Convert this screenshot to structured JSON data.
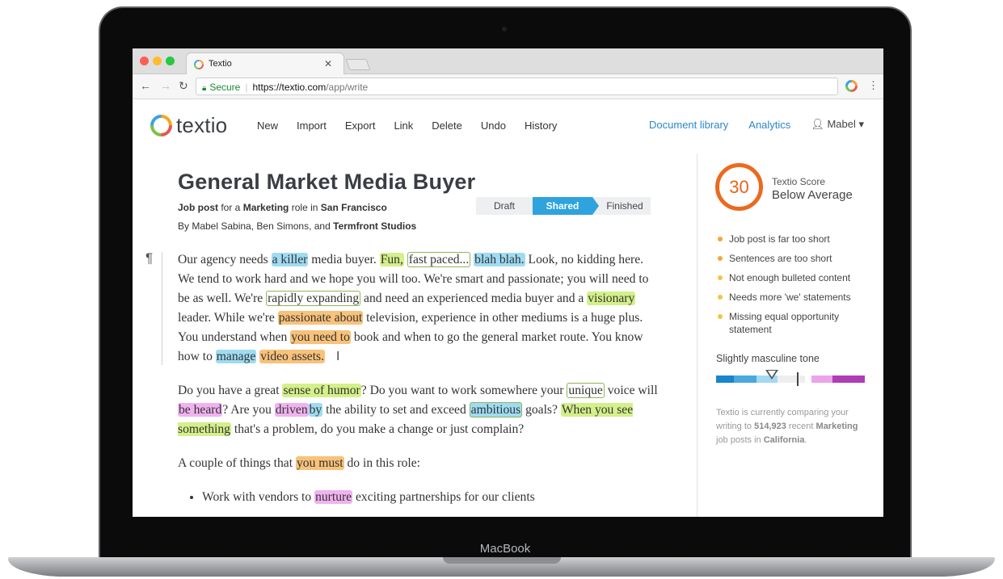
{
  "device": {
    "brand_label": "MacBook"
  },
  "browser": {
    "tab_title": "Textio",
    "secure_label": "Secure",
    "url_host": "https://textio.com",
    "url_path": "/app/write"
  },
  "app": {
    "logo_text": "textio",
    "menu": [
      "New",
      "Import",
      "Export",
      "Link",
      "Delete",
      "Undo",
      "History"
    ],
    "nav_document_library": "Document library",
    "nav_analytics": "Analytics",
    "user_name": "Mabel"
  },
  "document": {
    "title": "General Market Media Buyer",
    "meta_prefix": "Job post",
    "meta_for": "for a",
    "meta_role": "Marketing",
    "meta_role_suffix": "role in",
    "meta_location": "San Francisco",
    "byline_prefix": "By Mabel Sabina, Ben Simons, and",
    "byline_org": "Termfront Studios",
    "stages": [
      "Draft",
      "Shared",
      "Finished"
    ],
    "active_stage": "Shared",
    "pilcrow": "¶",
    "p1": {
      "t1": "Our agency needs ",
      "h1": "a killer",
      "t2": " media buyer. ",
      "h2": "Fun,",
      "t3": " ",
      "h3": "fast paced...",
      "t4": " ",
      "h4": "blah blah.",
      "t5": " Look, no kidding here. We tend to work hard and we hope you will too. We're smart and passionate; you will need to be as well. We're ",
      "h5": "rapidly expanding",
      "t6": " and need an experienced media buyer and a ",
      "h6": "visionary",
      "t7": " leader. While we're ",
      "h7": "passionate about",
      "t8": " television, experience in other mediums is a huge plus. You understand when ",
      "h8": "you need to",
      "t9": " book and when to go the general market route. You know how to ",
      "h9": "manage",
      "t10": " ",
      "h10": "video assets."
    },
    "p2": {
      "t1": "Do you have a great ",
      "h1": "sense of humor",
      "t2": "? Do you want to work somewhere your ",
      "h2": "unique",
      "t3": " voice will ",
      "h3": "be heard",
      "t4": "? Are you ",
      "h4": "driven",
      "h5": "by",
      "t5": " the ability to set and exceed ",
      "h6": "ambitious",
      "t6": " goals? ",
      "h7": "When you see something",
      "t7": " that's a problem, do you make a change or just complain?"
    },
    "p3": {
      "t1": "A couple of things that ",
      "h1": "you must",
      "t2": " do in this role:"
    },
    "bullet1": {
      "t1": "Work with vendors to ",
      "h1": "nurture",
      "t2": " exciting partnerships for our clients"
    }
  },
  "sidebar": {
    "score": "30",
    "score_label": "Textio Score",
    "score_value": "Below Average",
    "issues": [
      "Job post is far too short",
      "Sentences are too short",
      "Not enough bulleted content",
      "Needs more 'we' statements",
      "Missing equal opportunity statement"
    ],
    "tone_label": "Slightly masculine tone",
    "tone_level": 0.38,
    "compare_prefix": "Textio is currently comparing your writing to ",
    "compare_count": "514,923",
    "compare_mid": " recent ",
    "compare_role": "Marketing",
    "compare_mid2": " job posts in ",
    "compare_location": "California",
    "compare_end": "."
  },
  "colors": {
    "highlight_blue": "#9fdcf3",
    "highlight_green": "#d4f08a",
    "highlight_orange": "#f8c27a",
    "highlight_pink": "#f0b3ef",
    "score_orange": "#eb6a1f",
    "shared_blue": "#2ea3dd",
    "link_blue": "#2b87c8"
  }
}
